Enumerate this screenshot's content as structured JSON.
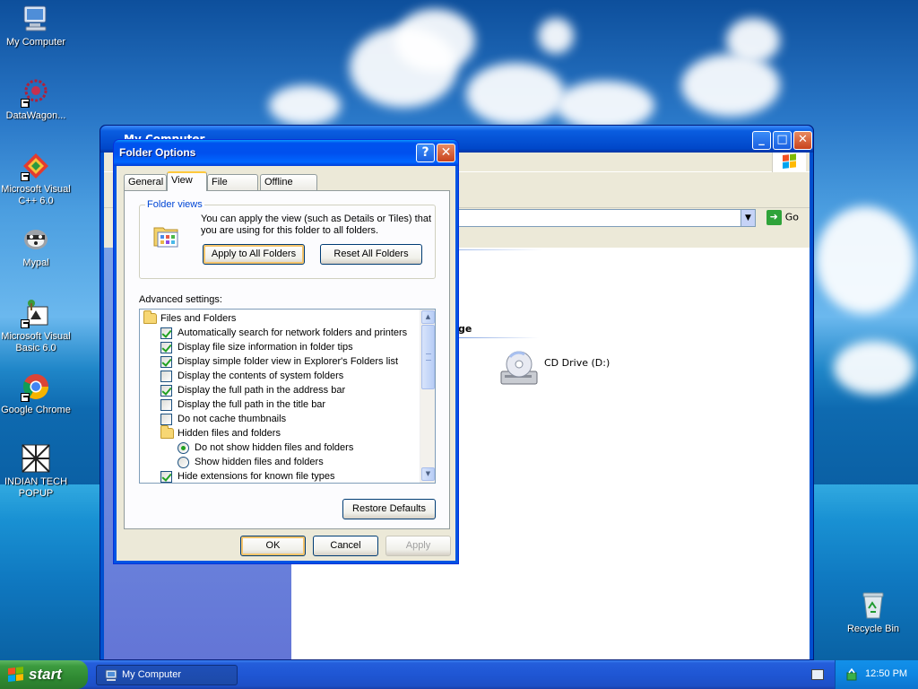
{
  "desktop": {
    "icons": [
      {
        "label": "My Computer"
      },
      {
        "label": "DataWagon..."
      },
      {
        "label": "Microsoft Visual C++ 6.0"
      },
      {
        "label": "Mypal"
      },
      {
        "label": "Microsoft Visual Basic 6.0"
      },
      {
        "label": "Google Chrome"
      },
      {
        "label": "INDIAN TECH POPUP"
      },
      {
        "label": "Recycle Bin"
      }
    ]
  },
  "mycomputer": {
    "title": "My Computer",
    "go_label": "Go",
    "group_header": "ge",
    "drive_label": "CD Drive (D:)"
  },
  "folder_options": {
    "title": "Folder Options",
    "tabs": [
      "General",
      "View",
      "File Types",
      "Offline Files"
    ],
    "active_tab": "View",
    "folder_views": {
      "label": "Folder views",
      "description": "You can apply the view (such as Details or Tiles) that you are using for this folder to all folders.",
      "apply_btn": "Apply to All Folders",
      "reset_btn": "Reset All Folders"
    },
    "advanced_label": "Advanced settings:",
    "settings": [
      {
        "text": "Files and Folders",
        "kind": "folder",
        "checked": false
      },
      {
        "text": "Automatically search for network folders and printers",
        "kind": "check",
        "checked": true
      },
      {
        "text": "Display file size information in folder tips",
        "kind": "check",
        "checked": true
      },
      {
        "text": "Display simple folder view in Explorer's Folders list",
        "kind": "check",
        "checked": true
      },
      {
        "text": "Display the contents of system folders",
        "kind": "check",
        "checked": false
      },
      {
        "text": "Display the full path in the address bar",
        "kind": "check",
        "checked": true
      },
      {
        "text": "Display the full path in the title bar",
        "kind": "check",
        "checked": false
      },
      {
        "text": "Do not cache thumbnails",
        "kind": "check",
        "checked": false
      },
      {
        "text": "Hidden files and folders",
        "kind": "folder",
        "checked": false
      },
      {
        "text": "Do not show hidden files and folders",
        "kind": "radio",
        "checked": true
      },
      {
        "text": "Show hidden files and folders",
        "kind": "radio",
        "checked": false
      },
      {
        "text": "Hide extensions for known file types",
        "kind": "check",
        "checked": true
      }
    ],
    "restore_btn": "Restore Defaults",
    "ok_btn": "OK",
    "cancel_btn": "Cancel",
    "apply_btn": "Apply"
  },
  "taskbar": {
    "start_label": "start",
    "task_label": "My Computer",
    "clock": "12:50 PM"
  },
  "colors": {
    "xp_title_blue": "#0054e3",
    "dialog_face": "#ece9d8",
    "start_green": "#3c9b3f"
  }
}
